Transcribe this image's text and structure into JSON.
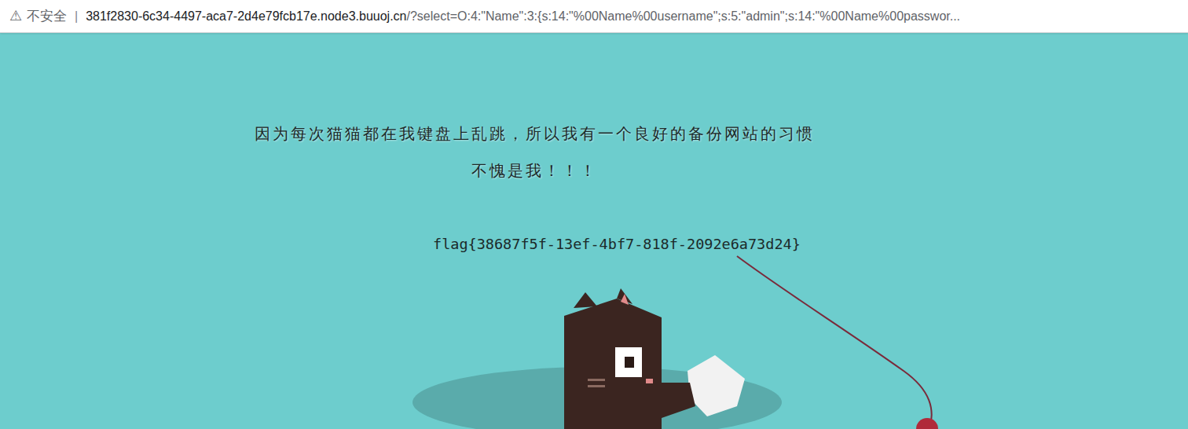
{
  "address_bar": {
    "security_icon": "⚠",
    "security_label": "不安全",
    "separator": "|",
    "host": "381f2830-6c34-4497-aca7-2d4e79fcb17e.node3.buuoj.cn",
    "path": "/?select=O:4:\"Name\":3:{s:14:\"%00Name%00username\";s:5:\"admin\";s:14:\"%00Name%00passwor..."
  },
  "page": {
    "lines": [
      "因为每次猫猫都在我键盘上乱跳，所以我有一个良好的备份网站的习惯",
      "不愧是我！！！"
    ],
    "flag": "flag{38687f5f-13ef-4bf7-818f-2092e6a73d24}"
  }
}
